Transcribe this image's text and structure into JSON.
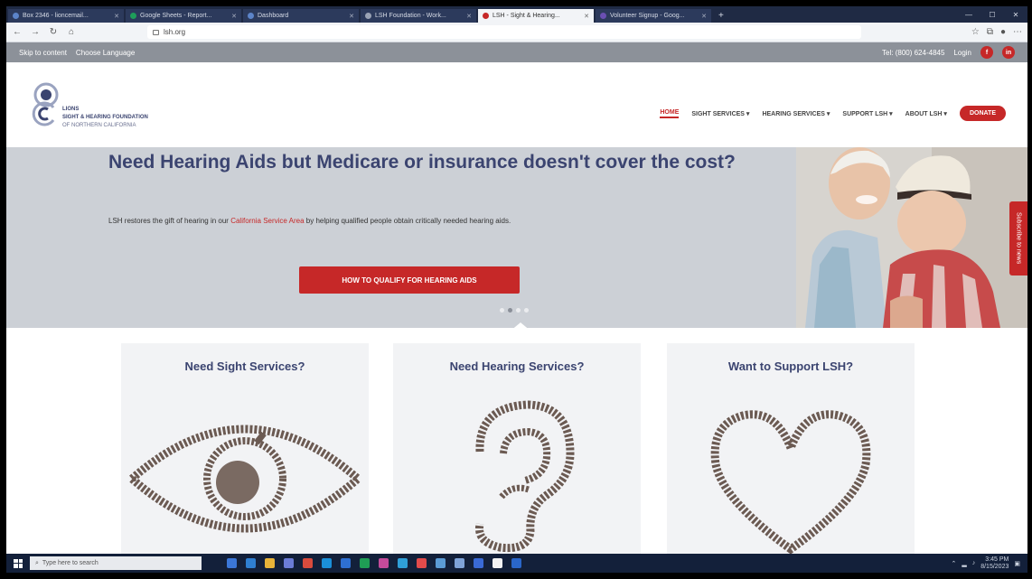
{
  "browser": {
    "tabs": [
      {
        "title": "Box 2346 - lioncemail...",
        "active": false
      },
      {
        "title": "Google Sheets - Report...",
        "active": false
      },
      {
        "title": "Dashboard",
        "active": false
      },
      {
        "title": "LSH Foundation - Work...",
        "active": false
      },
      {
        "title": "LSH - Sight & Hearing...",
        "active": true
      },
      {
        "title": "Volunteer Signup - Goog...",
        "active": false
      }
    ],
    "new_tab": "+",
    "url": "lsh.org",
    "window_controls": [
      "—",
      "☐",
      "✕"
    ]
  },
  "utility_bar": {
    "skip_link": "Skip to content",
    "language": "Choose Language",
    "phone": "Tel: (800) 624-4845",
    "login": "Login",
    "social": [
      "f",
      "in"
    ]
  },
  "site": {
    "logo_text": [
      "LIONS",
      "SIGHT & HEARING FOUNDATION",
      "OF NORTHERN CALIFORNIA"
    ],
    "nav": [
      {
        "label": "HOME",
        "active": true
      },
      {
        "label": "SIGHT SERVICES ▾",
        "active": false
      },
      {
        "label": "HEARING SERVICES ▾",
        "active": false
      },
      {
        "label": "SUPPORT LSH ▾",
        "active": false
      },
      {
        "label": "ABOUT LSH ▾",
        "active": false
      }
    ],
    "donate_label": "DONATE"
  },
  "hero": {
    "title": "Need Hearing Aids but Medicare or insurance doesn't cover the cost?",
    "text_before": "LSH restores the gift of hearing in our ",
    "text_link": "California Service Area",
    "text_after": " by helping qualified people obtain critically needed hearing aids.",
    "cta_label": "HOW TO QUALIFY FOR HEARING AIDS",
    "slides": 4,
    "active_slide": 1,
    "side_tab": "Subscribe to news"
  },
  "cards": [
    {
      "title": "Need Sight Services?",
      "icon": "eye-icon"
    },
    {
      "title": "Need Hearing Services?",
      "icon": "ear-icon"
    },
    {
      "title": "Want to Support LSH?",
      "icon": "heart-icon"
    }
  ],
  "taskbar": {
    "search_placeholder": "Type here to search",
    "time": "3:45 PM",
    "date": "8/15/2023"
  },
  "colors": {
    "brand_red": "#c62828",
    "brand_navy": "#3b4470",
    "hero_bg": "#ccd0d6",
    "card_bg": "#f2f3f5"
  }
}
